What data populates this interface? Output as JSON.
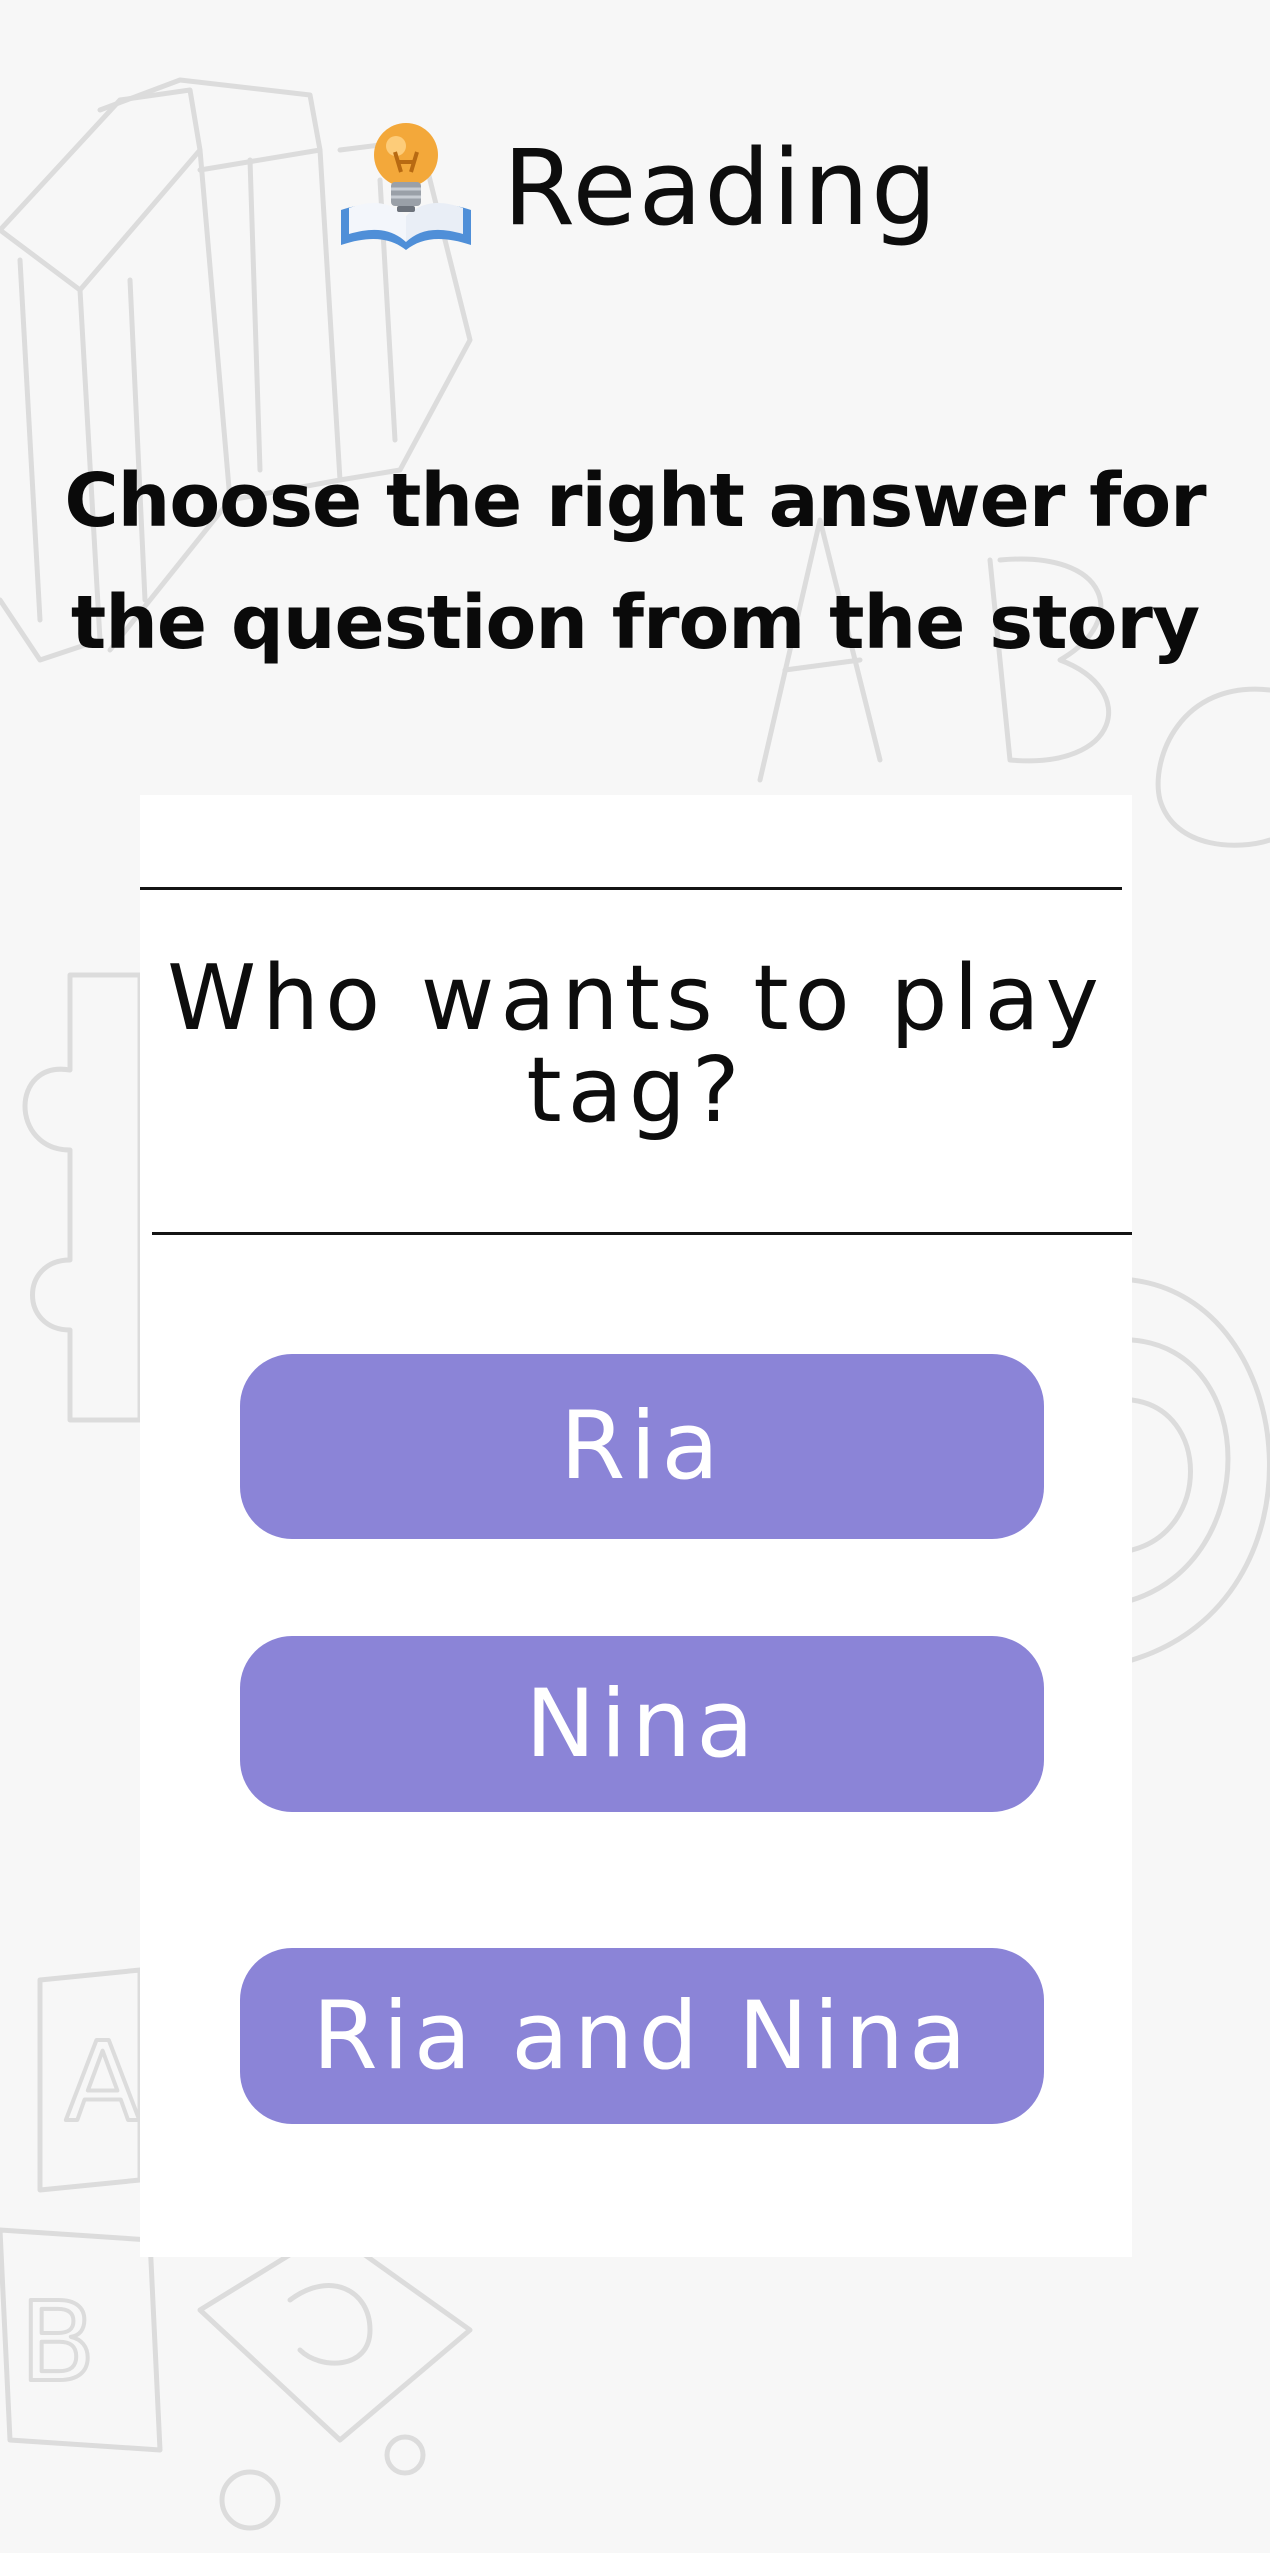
{
  "header": {
    "icon": "lightbulb-book-icon",
    "title": "Reading"
  },
  "instruction": "Choose the right answer for the question from the story",
  "question": "Who wants to play tag?",
  "options": [
    {
      "label": "Ria"
    },
    {
      "label": "Nina"
    },
    {
      "label": "Ria and Nina"
    }
  ],
  "colors": {
    "background": "#f7f7f7",
    "card": "#ffffff",
    "option_button": "#8b84d7",
    "option_text": "#ffffff",
    "text": "#0d0d0d"
  }
}
